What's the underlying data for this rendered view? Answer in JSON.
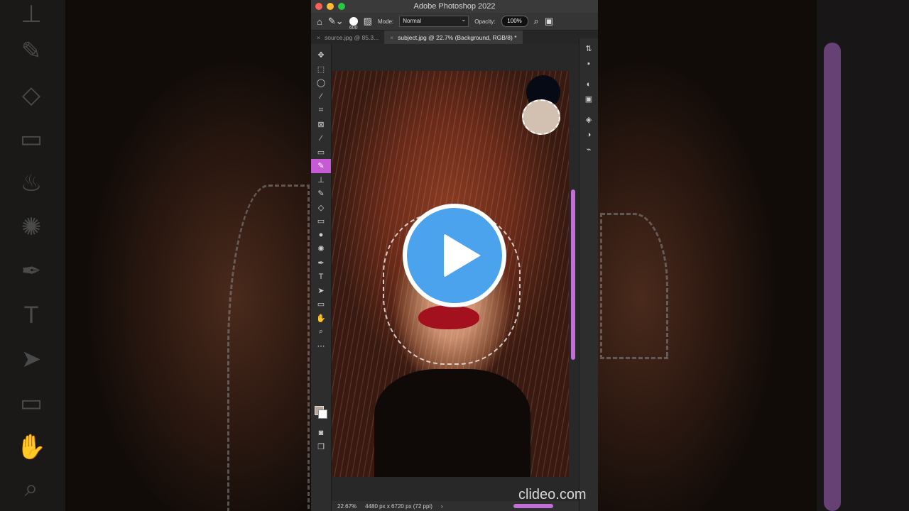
{
  "window": {
    "title": "Adobe Photoshop 2022"
  },
  "options_bar": {
    "brush_size": "600",
    "mode_label": "Mode:",
    "mode_value": "Normal",
    "opacity_label": "Opacity:",
    "opacity_value": "100%"
  },
  "tabs": [
    {
      "label": "source.jpg @ 85.3..."
    },
    {
      "label": "subject.jpg @ 22.7% (Background, RGB/8) *"
    }
  ],
  "tools": [
    "move-tool",
    "marquee-tool",
    "lasso-tool",
    "quick-selection-tool",
    "crop-tool",
    "frame-tool",
    "eyedropper-tool",
    "healing-brush-tool",
    "brush-tool",
    "clone-stamp-tool",
    "history-brush-tool",
    "eraser-tool",
    "gradient-tool",
    "blur-tool",
    "sponge-tool",
    "pen-tool",
    "type-tool",
    "path-selection-tool",
    "rectangle-tool",
    "hand-tool",
    "zoom-tool",
    "more-tools"
  ],
  "status": {
    "zoom": "22.67%",
    "document": "4480 px x 6720 px (72 ppi)",
    "arrow": "›"
  },
  "colors": {
    "accent": "#c75bd6",
    "play_button": "#4aa3ec",
    "foreground_swatch": "#b9a79a",
    "background_swatch": "#ffffff"
  },
  "watermark": "clideo.com"
}
